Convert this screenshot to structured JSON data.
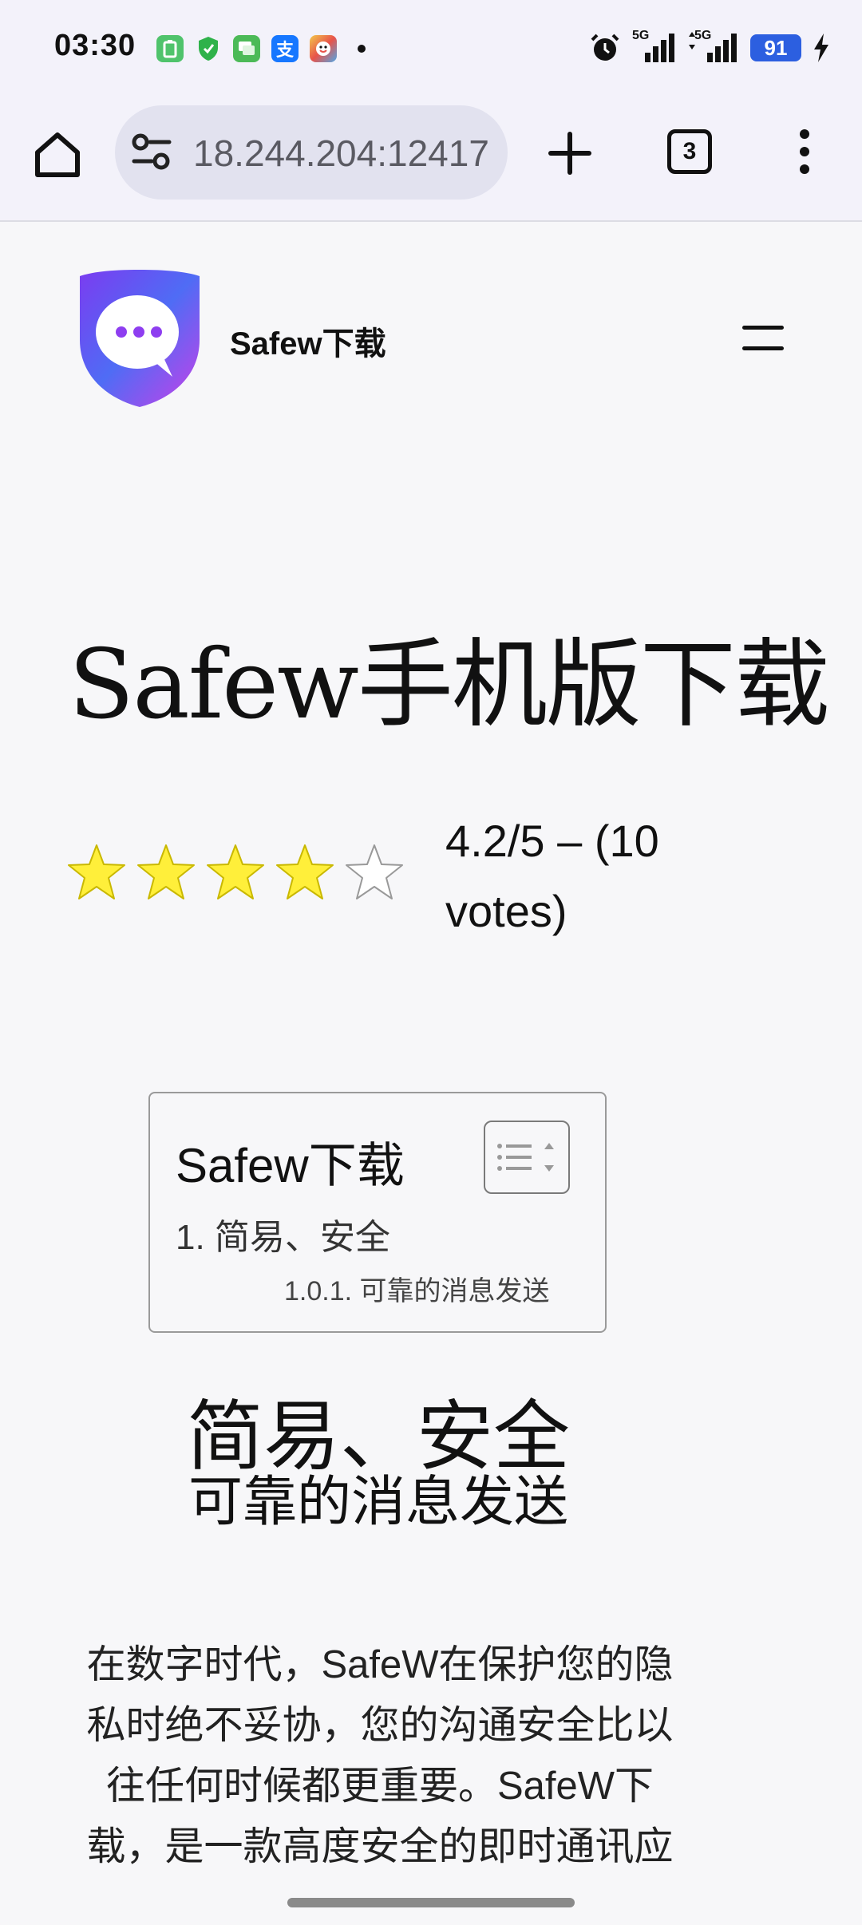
{
  "status_bar": {
    "time": "03:30",
    "network_1": "5G",
    "network_2": "5G",
    "battery": "91",
    "notification_apps": [
      {
        "icon": "battery-saver-app-icon",
        "color": "#4fc36b",
        "glyph": "▯"
      },
      {
        "icon": "security-shield-app-icon",
        "color": "#2fb24a",
        "glyph": "✓"
      },
      {
        "icon": "messages-app-icon",
        "color": "#4cba57",
        "glyph": "▤"
      },
      {
        "icon": "alipay-app-icon",
        "color": "#1677ff",
        "glyph": "支"
      },
      {
        "icon": "game-app-icon",
        "color": "#e8534a",
        "glyph": "☺"
      }
    ]
  },
  "browser": {
    "url": "18.244.204:12417",
    "tab_count": "3"
  },
  "site": {
    "name": "Safew下载",
    "logo_colors": [
      "#7b3cf0",
      "#3f7cf6",
      "#c740e8"
    ]
  },
  "page": {
    "title": "Safew手机版下载",
    "rating": {
      "text": "4.2/5 – (10 votes)",
      "value": 4.2,
      "max": 5,
      "filled_stars": 4,
      "star_color": "#ffef3a"
    },
    "toc": {
      "title": "Safew下载",
      "items": [
        {
          "label": "1. 简易、安全"
        },
        {
          "label": "1.0.1. 可靠的消息发送"
        }
      ]
    },
    "heading": "简易、安全",
    "subheading": "可靠的消息发送",
    "body": "在数字时代，SafeW在保护您的隐私时绝不妥协，您的沟通安全比以往任何时候都更重要。SafeW下载，是一款高度安全的即时通讯应"
  }
}
